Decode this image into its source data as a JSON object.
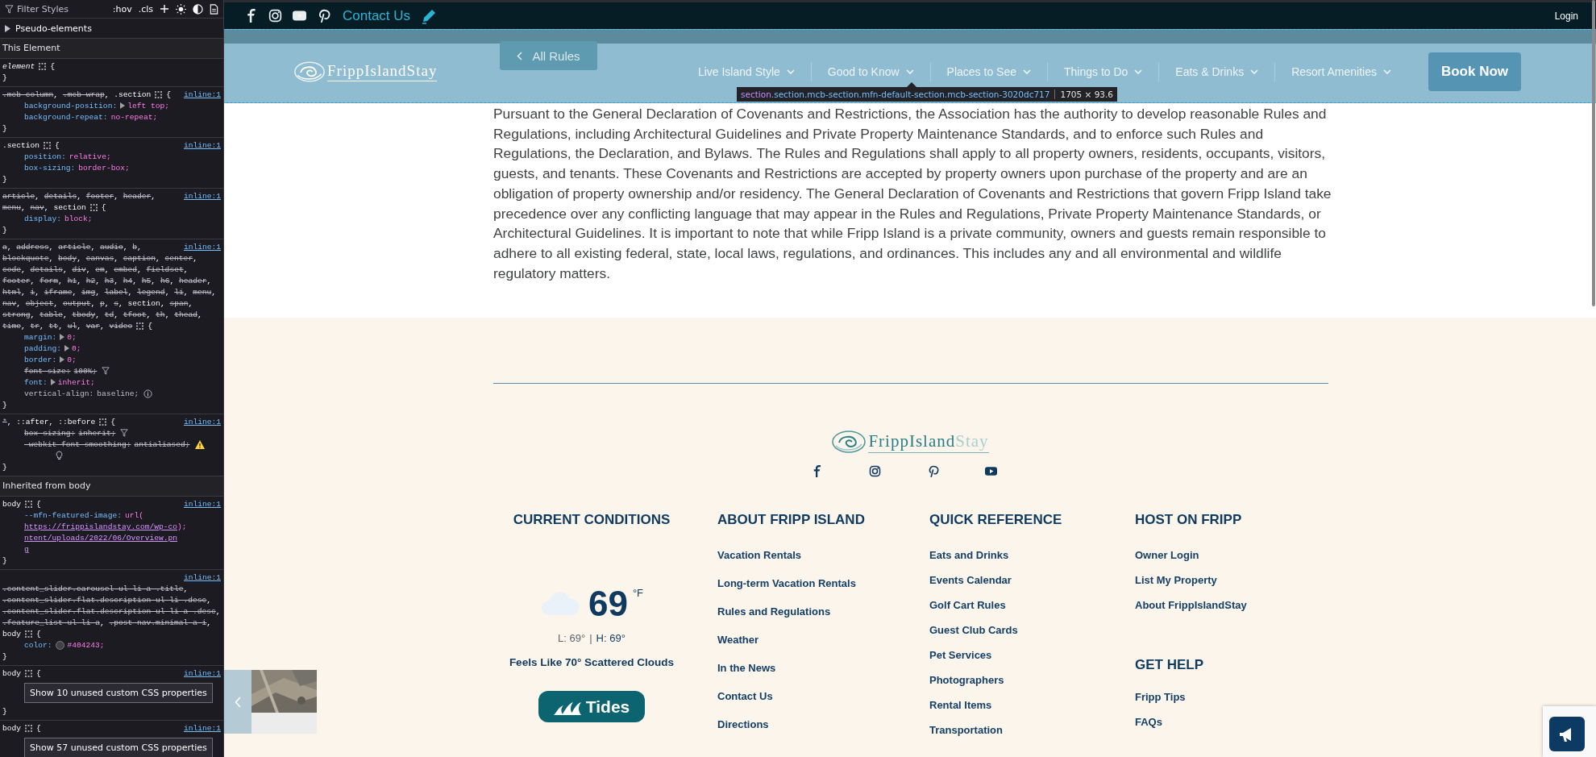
{
  "devtools": {
    "filter_placeholder": "Filter Styles",
    "toggles": [
      ":hov",
      ".cls"
    ],
    "pseudo_elements": {
      "label": "Pseudo-elements",
      "expanded": false
    },
    "this_element_label": "This Element",
    "rules": [
      {
        "kind": "element",
        "selector": [
          {
            "text": "element",
            "struck": false
          }
        ],
        "open": "{",
        "close": "}"
      },
      {
        "kind": "rule",
        "selector": [
          {
            "text": ".mcb-column",
            "struck": true,
            "sep": ","
          },
          {
            "text": ".mcb-wrap",
            "struck": true,
            "sep": ","
          },
          {
            "text": ".section",
            "struck": false
          }
        ],
        "source": "inline:1",
        "open": "{",
        "close": "}",
        "declarations": [
          {
            "name": "background-position:",
            "value": "left top;",
            "expandable": true,
            "struck": false
          },
          {
            "name": "background-repeat:",
            "value": "no-repeat;",
            "expandable": false,
            "struck": false
          }
        ]
      },
      {
        "kind": "rule",
        "selector": [
          {
            "text": ".section",
            "struck": false
          }
        ],
        "source": "inline:1",
        "open": "{",
        "close": "}",
        "declarations": [
          {
            "name": "position:",
            "value": "relative;",
            "expandable": false,
            "struck": false
          },
          {
            "name": "box-sizing:",
            "value": "border-box;",
            "expandable": false,
            "struck": false
          }
        ]
      },
      {
        "kind": "rule",
        "selector": [
          {
            "text": "article",
            "struck": true,
            "sep": ","
          },
          {
            "text": "details",
            "struck": true,
            "sep": ","
          },
          {
            "text": "footer",
            "struck": true,
            "sep": ","
          },
          {
            "text": "header",
            "struck": true,
            "sep": ","
          },
          {
            "text": "menu",
            "struck": true,
            "sep": ","
          },
          {
            "text": "nav",
            "struck": true,
            "sep": ","
          },
          {
            "text": "section",
            "struck": false
          }
        ],
        "source": "inline:1",
        "open": "{",
        "close": "}",
        "declarations": [
          {
            "name": "display:",
            "value": "block;",
            "expandable": false,
            "struck": false
          }
        ]
      },
      {
        "kind": "rule",
        "selector": [
          {
            "text": "a",
            "struck": true,
            "sep": ","
          },
          {
            "text": "address",
            "struck": true,
            "sep": ","
          },
          {
            "text": "article",
            "struck": true,
            "sep": ","
          },
          {
            "text": "audio",
            "struck": true,
            "sep": ","
          },
          {
            "text": "b",
            "struck": true,
            "sep": ","
          },
          {
            "text": "blockquote",
            "struck": true,
            "sep": ","
          },
          {
            "text": "body",
            "struck": true,
            "sep": ","
          },
          {
            "text": "canvas",
            "struck": true,
            "sep": ","
          },
          {
            "text": "caption",
            "struck": true,
            "sep": ","
          },
          {
            "text": "center",
            "struck": true,
            "sep": ","
          },
          {
            "text": "code",
            "struck": true,
            "sep": ","
          },
          {
            "text": "details",
            "struck": true,
            "sep": ","
          },
          {
            "text": "div",
            "struck": true,
            "sep": ","
          },
          {
            "text": "em",
            "struck": true,
            "sep": ","
          },
          {
            "text": "embed",
            "struck": true,
            "sep": ","
          },
          {
            "text": "fieldset",
            "struck": true,
            "sep": ","
          },
          {
            "text": "footer",
            "struck": true,
            "sep": ","
          },
          {
            "text": "form",
            "struck": true,
            "sep": ","
          },
          {
            "text": "h1",
            "struck": true,
            "sep": ","
          },
          {
            "text": "h2",
            "struck": true,
            "sep": ","
          },
          {
            "text": "h3",
            "struck": true,
            "sep": ","
          },
          {
            "text": "h4",
            "struck": true,
            "sep": ","
          },
          {
            "text": "h5",
            "struck": true,
            "sep": ","
          },
          {
            "text": "h6",
            "struck": true,
            "sep": ","
          },
          {
            "text": "header",
            "struck": true,
            "sep": ","
          },
          {
            "text": "html",
            "struck": true,
            "sep": ","
          },
          {
            "text": "i",
            "struck": true,
            "sep": ","
          },
          {
            "text": "iframe",
            "struck": true,
            "sep": ","
          },
          {
            "text": "img",
            "struck": true,
            "sep": ","
          },
          {
            "text": "label",
            "struck": true,
            "sep": ","
          },
          {
            "text": "legend",
            "struck": true,
            "sep": ","
          },
          {
            "text": "li",
            "struck": true,
            "sep": ","
          },
          {
            "text": "menu",
            "struck": true,
            "sep": ","
          },
          {
            "text": "nav",
            "struck": true,
            "sep": ","
          },
          {
            "text": "object",
            "struck": true,
            "sep": ","
          },
          {
            "text": "output",
            "struck": true,
            "sep": ","
          },
          {
            "text": "p",
            "struck": true,
            "sep": ","
          },
          {
            "text": "s",
            "struck": true,
            "sep": ","
          },
          {
            "text": "section",
            "struck": false,
            "sep": ","
          },
          {
            "text": "span",
            "struck": true,
            "sep": ","
          },
          {
            "text": "strong",
            "struck": true,
            "sep": ","
          },
          {
            "text": "table",
            "struck": true,
            "sep": ","
          },
          {
            "text": "tbody",
            "struck": true,
            "sep": ","
          },
          {
            "text": "td",
            "struck": true,
            "sep": ","
          },
          {
            "text": "tfoot",
            "struck": true,
            "sep": ","
          },
          {
            "text": "th",
            "struck": true,
            "sep": ","
          },
          {
            "text": "thead",
            "struck": true,
            "sep": ","
          },
          {
            "text": "time",
            "struck": true,
            "sep": ","
          },
          {
            "text": "tr",
            "struck": true,
            "sep": ","
          },
          {
            "text": "tt",
            "struck": true,
            "sep": ","
          },
          {
            "text": "ul",
            "struck": true,
            "sep": ","
          },
          {
            "text": "var",
            "struck": true,
            "sep": ","
          },
          {
            "text": "video",
            "struck": true
          }
        ],
        "source": "inline:1",
        "open": "{",
        "close": "}",
        "declarations": [
          {
            "name": "margin:",
            "value": "0;",
            "expandable": true,
            "struck": false
          },
          {
            "name": "padding:",
            "value": "0;",
            "expandable": true,
            "struck": false
          },
          {
            "name": "border:",
            "value": "0;",
            "expandable": true,
            "struck": false
          },
          {
            "name": "font-size:",
            "value": "100%;",
            "expandable": false,
            "struck": true,
            "filter_note": true
          },
          {
            "name": "font:",
            "value": "inherit;",
            "expandable": true,
            "struck": false
          },
          {
            "name": "vertical-align:",
            "value": "baseline;",
            "expandable": false,
            "struck": false,
            "inactive": true,
            "info_note": true
          }
        ]
      },
      {
        "kind": "rule",
        "selector": [
          {
            "text": "*",
            "struck": true,
            "sep": ","
          },
          {
            "text": "::after",
            "struck": false,
            "sep": ","
          },
          {
            "text": "::before",
            "struck": false
          }
        ],
        "source": "inline:1",
        "open": "{",
        "close": "}",
        "declarations": [
          {
            "name": "box-sizing:",
            "value": "inherit;",
            "expandable": false,
            "struck": true,
            "filter_note": true
          },
          {
            "name": "-webkit-font-smoothing:",
            "value": "antialiased;",
            "expandable": false,
            "struck": true,
            "warning_note": true,
            "lightbulb": true
          }
        ]
      }
    ],
    "inherited_label": "Inherited from body",
    "inherited_rules": [
      {
        "kind": "rule",
        "selector": [
          {
            "text": "body",
            "struck": false
          }
        ],
        "source": "inline:1",
        "open": "{",
        "close": "}",
        "declarations": [
          {
            "name": "--mfn-featured-image:",
            "value": "url(",
            "link": "https://frippislandstay.com/wp-content/uploads/2022/06/Overview.png",
            "value_end": ");",
            "expandable": false,
            "struck": false
          }
        ]
      },
      {
        "kind": "rule",
        "selector": [
          {
            "text": ".content_slider.carousel ul li a .title",
            "struck": true,
            "sep": ","
          },
          {
            "text": ".content_slider.flat.description ul li .desc",
            "struck": true,
            "sep": ","
          },
          {
            "text": ".content_slider.flat.description ul li a .desc",
            "struck": true,
            "sep": ","
          },
          {
            "text": ".feature_list ul li a",
            "struck": true,
            "sep": ","
          },
          {
            "text": ".post-nav.minimal a i",
            "struck": true,
            "sep": ","
          },
          {
            "text": "body",
            "struck": false
          }
        ],
        "source": "inline:1",
        "open": "{",
        "close": "}",
        "declarations": [
          {
            "name": "color:",
            "value": "#404243;",
            "color": "#404243",
            "expandable": false,
            "struck": false
          }
        ]
      },
      {
        "kind": "rule",
        "selector": [
          {
            "text": "body",
            "struck": false
          }
        ],
        "source": "inline:1",
        "open": "{",
        "close": "}",
        "button": "Show 10 unused custom CSS properties"
      },
      {
        "kind": "rule",
        "selector": [
          {
            "text": "body",
            "struck": false
          }
        ],
        "source": "inline:1",
        "open": "{",
        "button": "Show 57 unused custom CSS properties"
      }
    ]
  },
  "top_bar": {
    "contact_link": "Contact Us",
    "login_link": "Login"
  },
  "back_button": "All Rules",
  "nav": {
    "logo": {
      "main": "FrippIsland",
      "accent": "Stay"
    },
    "items": [
      {
        "label": "Live Island Style",
        "has_dropdown": true
      },
      {
        "label": "Good to Know",
        "has_dropdown": true
      },
      {
        "label": "Places to See",
        "has_dropdown": true
      },
      {
        "label": "Things to Do",
        "has_dropdown": true
      },
      {
        "label": "Eats & Drinks",
        "has_dropdown": true
      },
      {
        "label": "Resort Amenities",
        "has_dropdown": true
      }
    ],
    "cta": "Book Now"
  },
  "content": {
    "paragraph": "Pursuant to the General Declaration of Covenants and Restrictions, the Association has the authority to develop reasonable Rules and Regulations, including Architectural Guidelines and Private Property Maintenance Standards, and to enforce such Rules and Regulations, the Declaration, and Bylaws. The Rules and Regulations shall apply to all property owners, residents, occupants, visitors, guests, and tenants. These Covenants and Restrictions are accepted by property owners upon purchase of the property and are an obligation of property ownership and/or residency. The General Declaration of Covenants and Restrictions that govern Fripp Island take precedence over any conflicting language that may appear in the Rules and Regulations, Private Property Maintenance Standards, or Architectural Guidelines. It is important to note that while Fripp Island is a private community, owners and guests remain responsible to adhere to all existing federal, state, local laws, regulations, and ordinances. This includes any and all environmental and wildlife regulatory matters."
  },
  "inspector_tooltip": {
    "tag": "section",
    "classes": ".section.mcb-section.mfn-default-section.mcb-section-3020dc717",
    "size": "1705 × 93.6"
  },
  "footer": {
    "logo": {
      "main": "FrippIsland",
      "accent": "Stay"
    },
    "conditions": {
      "heading": "CURRENT CONDITIONS",
      "temperature": "69",
      "unit": "°F",
      "low": "L: 69°",
      "separator": "|",
      "high": "H: 69°",
      "feels_like": "Feels Like 70° Scattered Clouds",
      "tides_button": "Tides"
    },
    "columns": [
      {
        "groups": [
          {
            "heading": "ABOUT FRIPP ISLAND",
            "links": [
              "Vacation Rentals",
              "Long-term Vacation Rentals",
              "Rules and Regulations",
              "Weather",
              "In the News",
              "Contact Us",
              "Directions"
            ]
          }
        ]
      },
      {
        "groups": [
          {
            "heading": "QUICK REFERENCE",
            "links": [
              "Eats and Drinks",
              "Events Calendar",
              "Golf Cart Rules",
              "Guest Club Cards",
              "Pet Services",
              "Photographers",
              "Rental Items",
              "Transportation"
            ]
          }
        ]
      },
      {
        "groups": [
          {
            "heading": "HOST ON FRIPP",
            "links": [
              "Owner Login",
              "List My Property",
              "About FrippIslandStay"
            ]
          },
          {
            "heading": "GET HELP",
            "links": [
              "Fripp Tips",
              "FAQs"
            ]
          }
        ]
      }
    ]
  }
}
